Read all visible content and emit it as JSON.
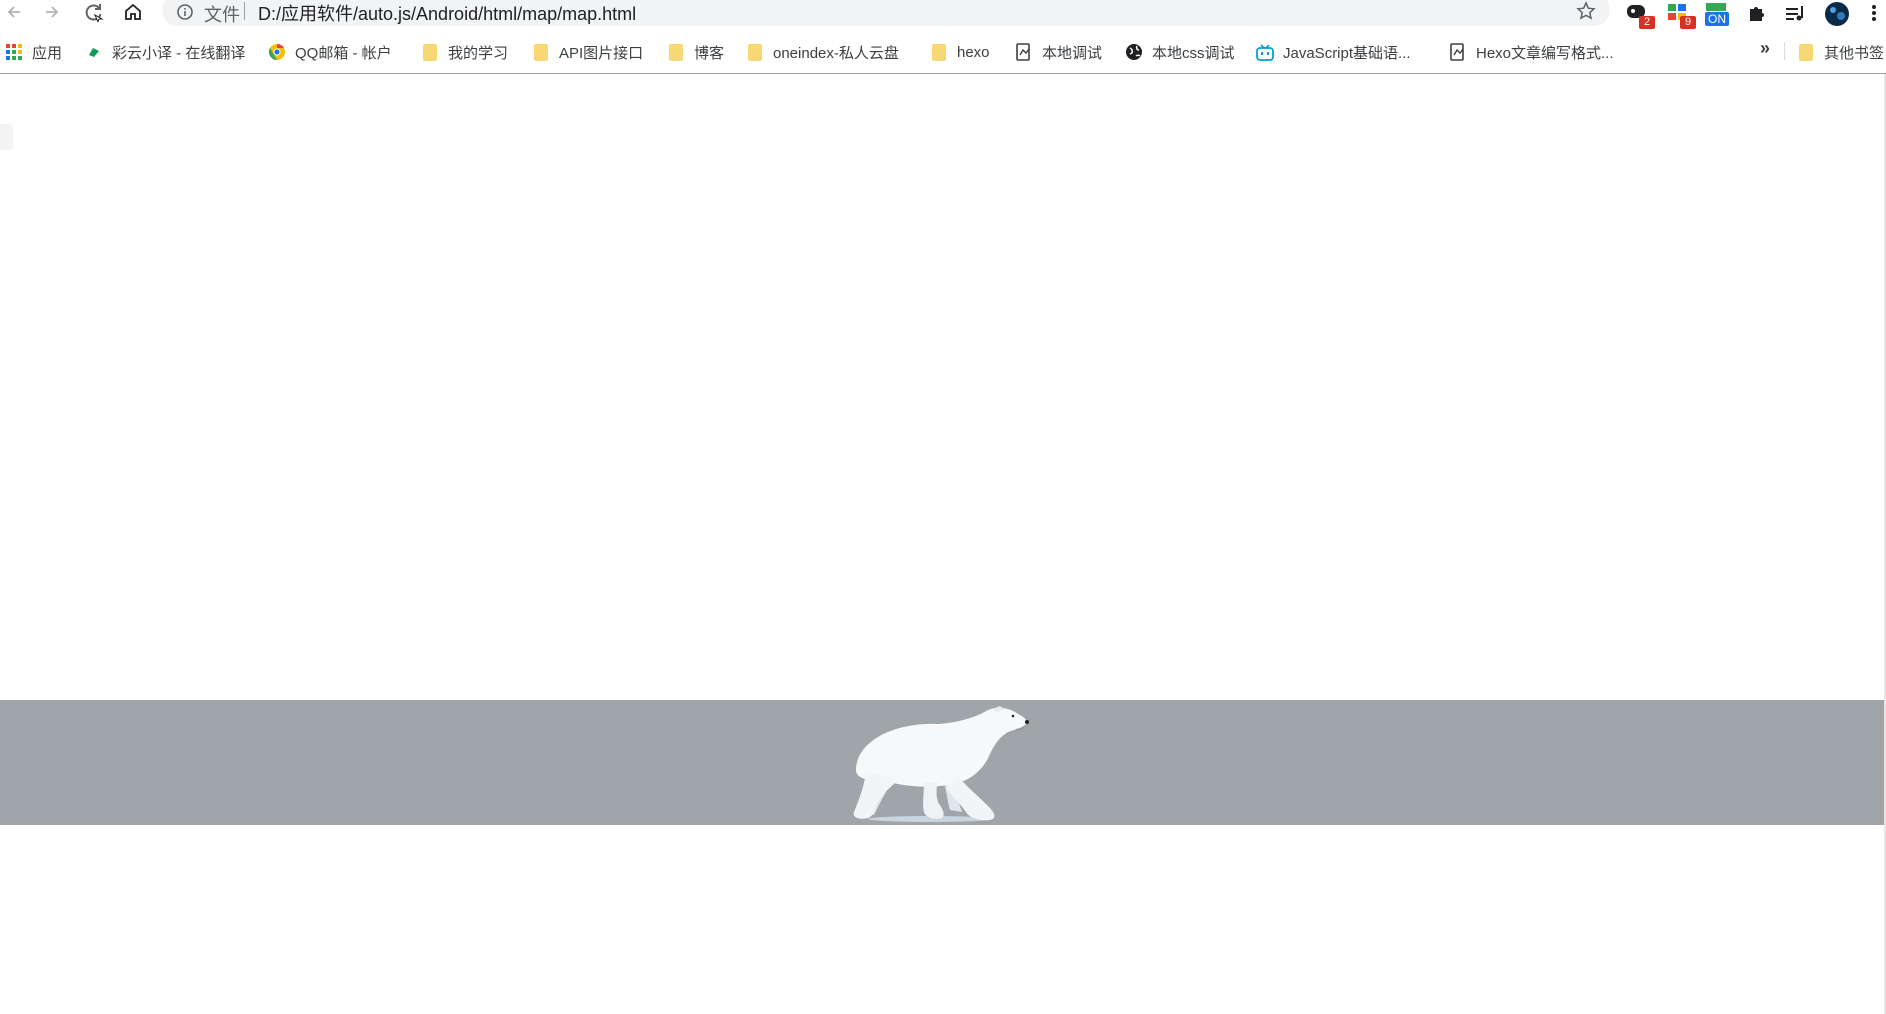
{
  "browser": {
    "address_bar": {
      "scheme_label": "文件",
      "url": "D:/应用软件/auto.js/Android/html/map/map.html"
    },
    "nav_icons": [
      "back-arrow-icon",
      "forward-arrow-icon",
      "reload-icon",
      "home-icon"
    ],
    "extensions": [
      {
        "name": "extension-icon-1",
        "badge": "2",
        "badge_color": "#d93025"
      },
      {
        "name": "extension-icon-2",
        "badge": "9",
        "badge_color": "#d93025"
      },
      {
        "name": "extension-icon-3",
        "badge": "ON",
        "badge_color": "#1a73e8"
      }
    ]
  },
  "bookmarks": {
    "items": [
      {
        "label": "应用",
        "icon": "apps-grid-icon"
      },
      {
        "label": "彩云小译 - 在线翻译",
        "icon": "caiyun-icon"
      },
      {
        "label": "QQ邮箱 - 帐户",
        "icon": "chrome-icon"
      },
      {
        "label": "我的学习",
        "icon": "folder-icon"
      },
      {
        "label": "API图片接口",
        "icon": "folder-icon"
      },
      {
        "label": "博客",
        "icon": "folder-icon"
      },
      {
        "label": "oneindex-私人云盘",
        "icon": "folder-icon"
      },
      {
        "label": "hexo",
        "icon": "folder-icon"
      },
      {
        "label": "本地调试",
        "icon": "page-icon"
      },
      {
        "label": "本地css调试",
        "icon": "globe-icon"
      },
      {
        "label": "JavaScript基础语...",
        "icon": "bilibili-icon"
      },
      {
        "label": "Hexo文章编写格式...",
        "icon": "page-icon"
      }
    ],
    "overflow_label": "»",
    "other_label": "其他书签"
  },
  "page": {
    "band_color": "#a0a5a9",
    "illustration": "polar-bear-walking"
  }
}
